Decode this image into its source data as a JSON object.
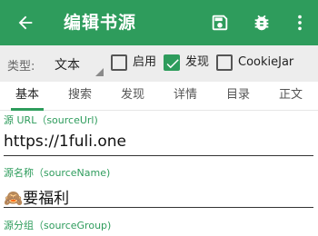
{
  "appbar": {
    "title": "编辑书源",
    "back_icon": "arrow-left-icon",
    "save_icon": "save-icon",
    "debug_icon": "bug-icon",
    "more_icon": "more-vert-icon",
    "color": "#2e9c5c"
  },
  "typebar": {
    "type_label": "类型:",
    "type_value": "文本",
    "checkboxes": [
      {
        "label": "启用",
        "checked": false
      },
      {
        "label": "发现",
        "checked": true
      },
      {
        "label": "CookieJar",
        "checked": false
      }
    ]
  },
  "tabs": [
    {
      "label": "基本",
      "active": true
    },
    {
      "label": "搜索",
      "active": false
    },
    {
      "label": "发现",
      "active": false
    },
    {
      "label": "详情",
      "active": false
    },
    {
      "label": "目录",
      "active": false
    },
    {
      "label": "正文",
      "active": false
    }
  ],
  "fields": {
    "source_url": {
      "label": "源 URL（sourceUrl)",
      "value": "https://1fuli.one"
    },
    "source_name": {
      "label": "源名称（sourceName)",
      "value": "🙈要福利"
    },
    "source_group": {
      "label": "源分组（sourceGroup)"
    }
  }
}
